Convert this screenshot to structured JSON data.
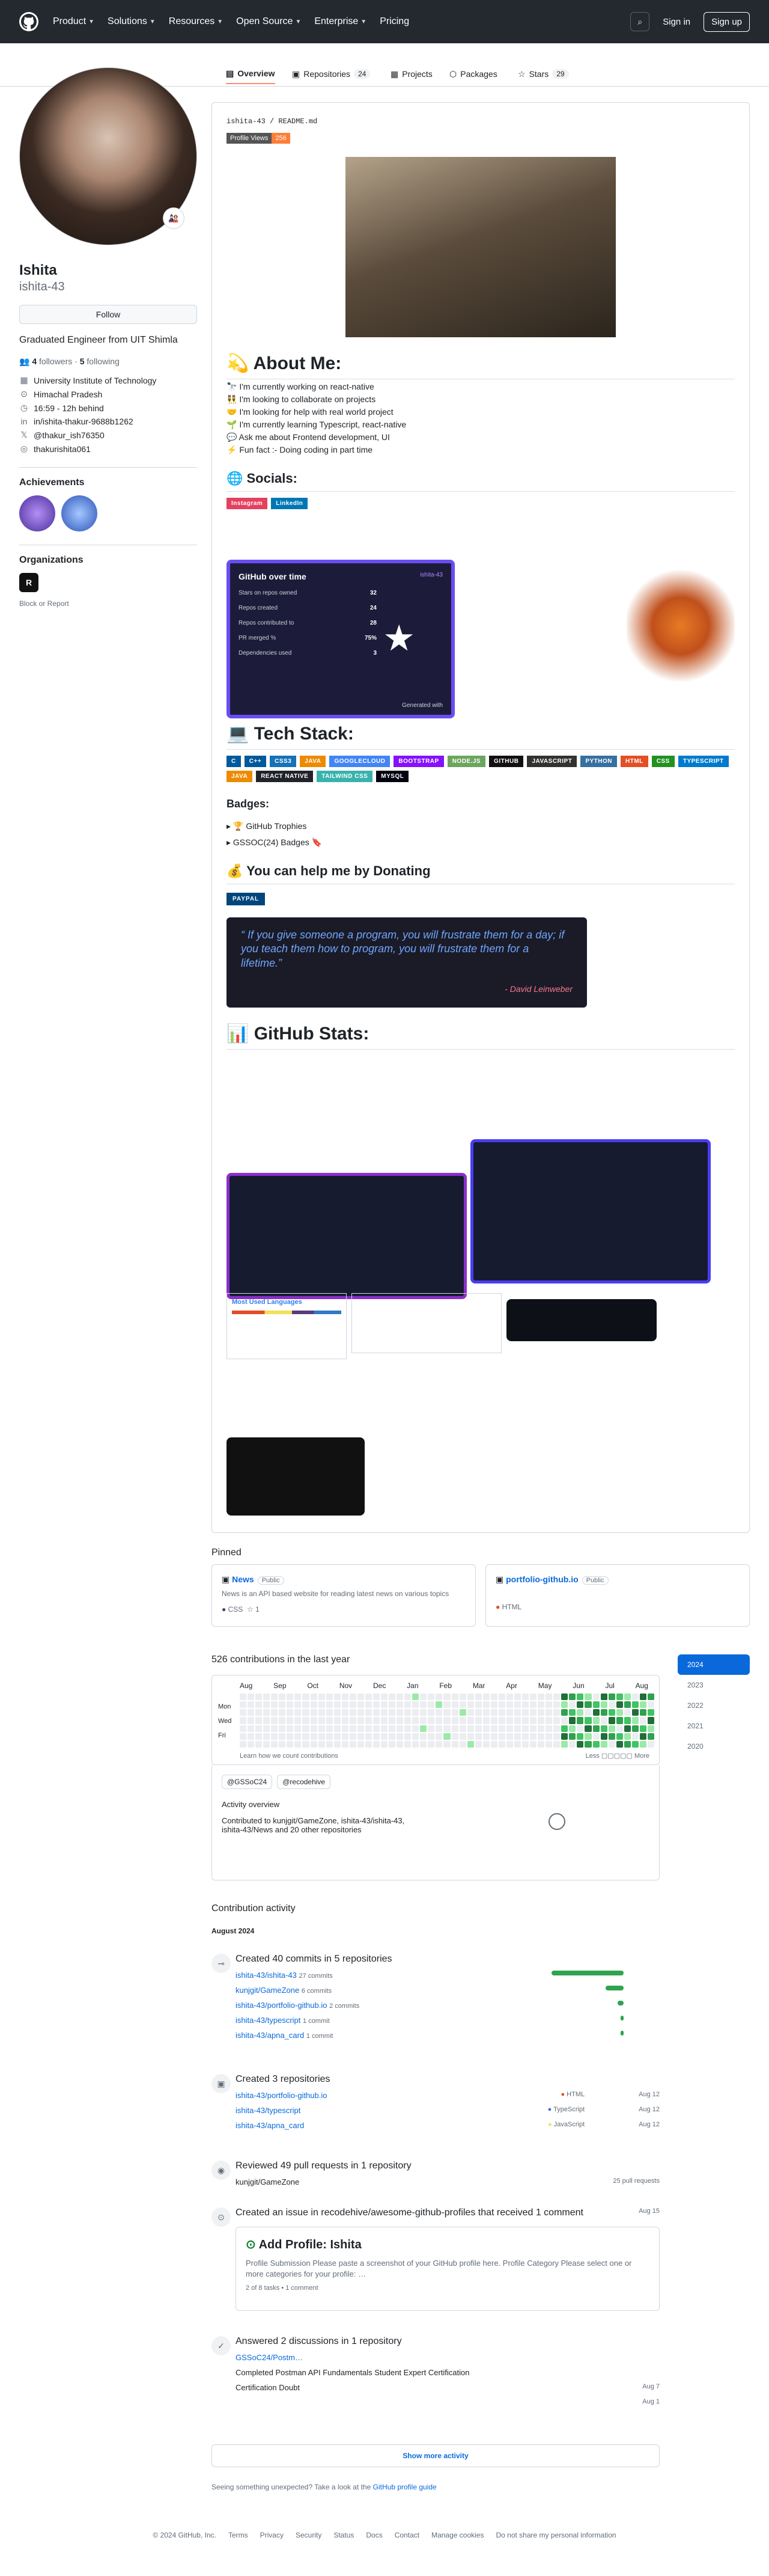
{
  "nav": {
    "items": [
      "Product",
      "Solutions",
      "Resources",
      "Open Source",
      "Enterprise",
      "Pricing"
    ],
    "sign_in": "Sign in",
    "sign_up": "Sign up"
  },
  "tabs": [
    {
      "label": "Overview"
    },
    {
      "label": "Repositories",
      "count": "24"
    },
    {
      "label": "Projects"
    },
    {
      "label": "Packages"
    },
    {
      "label": "Stars",
      "count": "29"
    }
  ],
  "profile": {
    "name": "Ishita",
    "login": "ishita-43",
    "follow": "Follow",
    "bio": "Graduated Engineer from UIT Shimla",
    "followers": "4",
    "followers_label": "followers",
    "following": "5",
    "following_label": "following",
    "details": [
      "University Institute of Technology",
      "Himachal Pradesh",
      "16:59 - 12h behind",
      "in/ishita-thakur-9688b1262",
      "@thakur_ish76350",
      "thakurishita061"
    ],
    "achievements_title": "Achievements",
    "orgs_title": "Organizations",
    "block": "Block or Report"
  },
  "readme": {
    "path": "ishita-43 / README.md",
    "views_label": "Profile Views",
    "views_count": "256",
    "about_title": "💫 About Me:",
    "about": [
      "🔭 I'm currently working on react-native",
      "👯 I'm looking to collaborate on projects",
      "🤝 I'm looking for help with real world project",
      "🌱 I'm currently learning Typescript, react-native",
      "💬 Ask me about Frontend development, UI",
      "⚡ Fun fact :- Doing coding in part time"
    ],
    "socials_title": "🌐 Socials:",
    "socials": [
      "Instagram",
      "LinkedIn"
    ],
    "ghtime": {
      "title": "GitHub over time",
      "user": "ishita-43",
      "stats": [
        [
          "Stars on repos owned",
          "32"
        ],
        [
          "Repos created",
          "24"
        ],
        [
          "Repos contributed to",
          "28"
        ],
        [
          "PR merged %",
          "75%"
        ],
        [
          "Dependencies used",
          "3"
        ]
      ],
      "footer": "Generated with"
    },
    "tech_title": "💻 Tech Stack:",
    "tech": [
      [
        "C",
        "#00599C"
      ],
      [
        "C++",
        "#00599C"
      ],
      [
        "CSS3",
        "#1572B6"
      ],
      [
        "JAVA",
        "#ED8B00"
      ],
      [
        "GOOGLECLOUD",
        "#4285F4"
      ],
      [
        "BOOTSTRAP",
        "#8511FA"
      ],
      [
        "NODE.JS",
        "#6DA55F"
      ],
      [
        "GITHUB",
        "#121011"
      ],
      [
        "JAVASCRIPT",
        "#323330"
      ],
      [
        "PYTHON",
        "#3670A0"
      ],
      [
        "HTML",
        "#E34F26"
      ],
      [
        "CSS",
        "#239120"
      ],
      [
        "TYPESCRIPT",
        "#007ACC"
      ],
      [
        "JAVA",
        "#ED8B00"
      ],
      [
        "REACT NATIVE",
        "#20232a"
      ],
      [
        "TAILWIND CSS",
        "#38B2AC"
      ],
      [
        "MYSQL",
        "#00000F"
      ]
    ],
    "badges_title": "Badges:",
    "badges": [
      "🏆 GitHub Trophies",
      "GSSOC(24) Badges 🔖"
    ],
    "donate_title": "💰 You can help me by Donating",
    "paypal": "PAYPAL",
    "quote": "“ If you give someone a program, you will frustrate them for a day; if you teach them how to program, you will frustrate them for a lifetime.”",
    "quote_author": "- David Leinweber",
    "stats_title": "📊 GitHub Stats:",
    "most_used": "Most Used Languages"
  },
  "pinned": {
    "title": "Pinned",
    "repos": [
      {
        "name": "News",
        "vis": "Public",
        "desc": "News is an API based website for reading latest news on various topics",
        "lang": "CSS",
        "stars": "1"
      },
      {
        "name": "portfolio-github.io",
        "vis": "Public",
        "desc": "",
        "lang": "HTML",
        "stars": ""
      }
    ]
  },
  "contrib": {
    "title": "526 contributions in the last year",
    "months": [
      "Aug",
      "Sep",
      "Oct",
      "Nov",
      "Dec",
      "Jan",
      "Feb",
      "Mar",
      "Apr",
      "May",
      "Jun",
      "Jul",
      "Aug"
    ],
    "days": [
      "Mon",
      "Wed",
      "Fri"
    ],
    "learn": "Learn how we count contributions",
    "less": "Less",
    "more": "More",
    "years": [
      "2024",
      "2023",
      "2022",
      "2021",
      "2020"
    ],
    "orgs": [
      "@GSSoC24",
      "@recodehive"
    ],
    "overview_title": "Activity overview",
    "overview_text": "Contributed to kunjgit/GameZone, ishita-43/ishita-43, ishita-43/News and 20 other repositories"
  },
  "activity": {
    "title": "Contribution activity",
    "month": "August 2024",
    "commits": {
      "title": "Created 40 commits in 5 repositories",
      "rows": [
        [
          "ishita-43/ishita-43",
          "27 commits"
        ],
        [
          "kunjgit/GameZone",
          "6 commits"
        ],
        [
          "ishita-43/portfolio-github.io",
          "2 commits"
        ],
        [
          "ishita-43/typescript",
          "1 commit"
        ],
        [
          "ishita-43/apna_card",
          "1 commit"
        ]
      ]
    },
    "repos": {
      "title": "Created 3 repositories",
      "rows": [
        [
          "ishita-43/portfolio-github.io",
          "HTML",
          "Aug 12"
        ],
        [
          "ishita-43/typescript",
          "TypeScript",
          "Aug 12"
        ],
        [
          "ishita-43/apna_card",
          "JavaScript",
          "Aug 12"
        ]
      ]
    },
    "prs": {
      "title": "Reviewed 49 pull requests in 1 repository",
      "repo": "kunjgit/GameZone",
      "count": "25 pull requests"
    },
    "issue": {
      "title": "Created an issue in recodehive/awesome-github-profiles that received 1 comment",
      "date": "Aug 15",
      "heading": "Add Profile: Ishita",
      "body": "Profile Submission Please paste a screenshot of your GitHub profile here. Profile Category Please select one or more categories for your profile: …",
      "tasks": "2 of 8 tasks • 1 comment"
    },
    "discussions": {
      "title": "Answered 2 discussions in 1 repository",
      "repo": "GSSoC24/Postm…",
      "rows": [
        [
          "Completed Postman API Fundamentals Student Expert Certification",
          "Aug 7"
        ],
        [
          "Certification Doubt",
          "Aug 1"
        ]
      ]
    },
    "show_more": "Show more activity",
    "unexpected": "Seeing something unexpected? Take a look at the",
    "guide": "GitHub profile guide"
  },
  "footer": [
    "© 2024 GitHub, Inc.",
    "Terms",
    "Privacy",
    "Security",
    "Status",
    "Docs",
    "Contact",
    "Manage cookies",
    "Do not share my personal information"
  ]
}
